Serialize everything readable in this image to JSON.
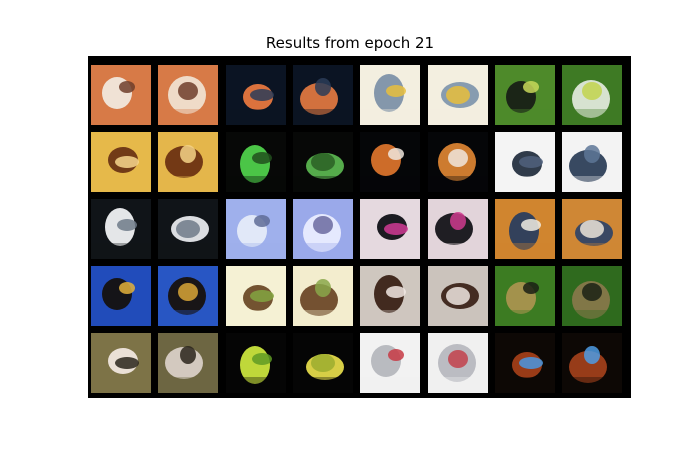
{
  "figure": {
    "title": "Results from epoch 21"
  },
  "grid": {
    "rows": 5,
    "pairs_per_row": 4,
    "tiles": [
      {
        "subject": "cat with bowl",
        "bg": "#d77a47",
        "fg": "#f1e8dd",
        "accent": "#6e3d2a"
      },
      {
        "subject": "cat with bowl",
        "bg": "#d77a47",
        "fg": "#f0e0d0",
        "accent": "#6e3d2a"
      },
      {
        "subject": "small cat",
        "bg": "#0b1423",
        "fg": "#e7773f",
        "accent": "#2c3c58"
      },
      {
        "subject": "small cat",
        "bg": "#0b1423",
        "fg": "#dd7640",
        "accent": "#2c3c58"
      },
      {
        "subject": "bright object",
        "bg": "#f3efe0",
        "fg": "#7d91a8",
        "accent": "#e8be3c"
      },
      {
        "subject": "bright object",
        "bg": "#f3efe0",
        "fg": "#8197ad",
        "accent": "#e8be3c"
      },
      {
        "subject": "animal in grass",
        "bg": "#4e8a2a",
        "fg": "#182016",
        "accent": "#c8d85a"
      },
      {
        "subject": "animal in grass",
        "bg": "#3e7a24",
        "fg": "#dfe8da",
        "accent": "#c2d34e"
      },
      {
        "subject": "horse",
        "bg": "#e6b94a",
        "fg": "#6c3414",
        "accent": "#f8d88e"
      },
      {
        "subject": "horse",
        "bg": "#e4b64b",
        "fg": "#6d3312",
        "accent": "#f4d487"
      },
      {
        "subject": "frog",
        "bg": "#070807",
        "fg": "#4fd04b",
        "accent": "#214f1d"
      },
      {
        "subject": "frog",
        "bg": "#070807",
        "fg": "#5ab44f",
        "accent": "#2b5f24"
      },
      {
        "subject": "cat face",
        "bg": "#050608",
        "fg": "#d8722b",
        "accent": "#f0e6dd"
      },
      {
        "subject": "cat face",
        "bg": "#050608",
        "fg": "#d88231",
        "accent": "#f0e6dd"
      },
      {
        "subject": "black cat",
        "bg": "#f4f4f4",
        "fg": "#253040",
        "accent": "#50627d"
      },
      {
        "subject": "black cat",
        "bg": "#f3f3f3",
        "fg": "#2d3f58",
        "accent": "#5d7596"
      },
      {
        "subject": "cat by window",
        "bg": "#101418",
        "fg": "#f0f1f3",
        "accent": "#6f7a88"
      },
      {
        "subject": "cat by window",
        "bg": "#101418",
        "fg": "#e7e8ec",
        "accent": "#6f7a88"
      },
      {
        "subject": "white fluffy cat",
        "bg": "#9fb0ec",
        "fg": "#e5ebf9",
        "accent": "#5f6c96"
      },
      {
        "subject": "white fluffy cat",
        "bg": "#9aa9ea",
        "fg": "#e9ecff",
        "accent": "#6b6aa0"
      },
      {
        "subject": "black cat on pink",
        "bg": "#e5d9df",
        "fg": "#101116",
        "accent": "#d03a94"
      },
      {
        "subject": "black cat on pink",
        "bg": "#e2d4da",
        "fg": "#141419",
        "accent": "#cf3b8e"
      },
      {
        "subject": "framed cat",
        "bg": "#d0852f",
        "fg": "#2a3d5e",
        "accent": "#f1ede3"
      },
      {
        "subject": "framed cat",
        "bg": "#cf8735",
        "fg": "#314566",
        "accent": "#ece5d8"
      },
      {
        "subject": "cat on blue screen",
        "bg": "#214cbb",
        "fg": "#15110f",
        "accent": "#e3b23c"
      },
      {
        "subject": "cat on blue screen",
        "bg": "#2856c4",
        "fg": "#17120e",
        "accent": "#d9a637"
      },
      {
        "subject": "deer",
        "bg": "#f5f1d4",
        "fg": "#6b4a28",
        "accent": "#82a441"
      },
      {
        "subject": "deer",
        "bg": "#f3edce",
        "fg": "#6d4928",
        "accent": "#8aa74a"
      },
      {
        "subject": "dog",
        "bg": "#cfc7bf",
        "fg": "#3a2216",
        "accent": "#f1e8e3"
      },
      {
        "subject": "dog",
        "bg": "#cbc3bc",
        "fg": "#3c2419",
        "accent": "#efe6e1"
      },
      {
        "subject": "cat in grass",
        "bg": "#3c7c22",
        "fg": "#a9934f",
        "accent": "#1a1f14"
      },
      {
        "subject": "cat in grass",
        "bg": "#2f6a1e",
        "fg": "#86784a",
        "accent": "#1b2115"
      },
      {
        "subject": "cat on ground",
        "bg": "#7d7347",
        "fg": "#f0e6de",
        "accent": "#2a241b"
      },
      {
        "subject": "cat on ground",
        "bg": "#6d6642",
        "fg": "#d9cfc6",
        "accent": "#2a241b"
      },
      {
        "subject": "green parrot",
        "bg": "#050505",
        "fg": "#c9e43d",
        "accent": "#5f9b24"
      },
      {
        "subject": "yellow bird",
        "bg": "#050505",
        "fg": "#e3d94a",
        "accent": "#9cad2f"
      },
      {
        "subject": "white car",
        "bg": "#f2f2f2",
        "fg": "#b5b7bd",
        "accent": "#c73a44"
      },
      {
        "subject": "white car",
        "bg": "#f0f0f0",
        "fg": "#b7b8bf",
        "accent": "#c2414b"
      },
      {
        "subject": "cat in blue",
        "bg": "#0d0805",
        "fg": "#a13e18",
        "accent": "#4a98e2"
      },
      {
        "subject": "cat in blue",
        "bg": "#0d0805",
        "fg": "#9f3f1a",
        "accent": "#4e9be4"
      }
    ]
  }
}
